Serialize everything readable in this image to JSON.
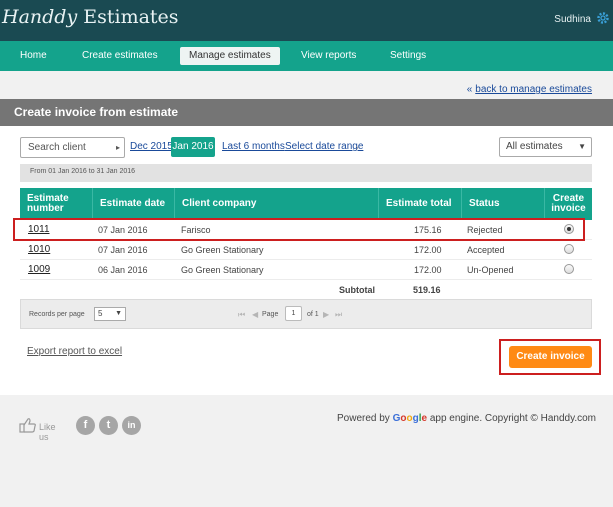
{
  "app": {
    "logo_script": "Handdy",
    "logo_text": "Estimates",
    "user_name": "Sudhina"
  },
  "nav": [
    {
      "label": "Home"
    },
    {
      "label": "Create estimates"
    },
    {
      "label": "Manage estimates"
    },
    {
      "label": "View reports"
    },
    {
      "label": "Settings"
    }
  ],
  "back_link": {
    "arrows": "«",
    "label": "back to manage estimates"
  },
  "panel": {
    "title": "Create invoice from estimate"
  },
  "filters": {
    "search_client": "Search client",
    "dec_2015": "Dec 2015",
    "jan_2016": "Jan 2016",
    "last_6_months": "Last 6 months",
    "select_date_range": "Select date range",
    "all_estimates": "All estimates",
    "date_range_text": "From 01 Jan 2016 to 31 Jan 2016"
  },
  "table": {
    "headers": {
      "estimate_number": "Estimate number",
      "estimate_date": "Estimate date",
      "client_company": "Client company",
      "estimate_total": "Estimate total",
      "status": "Status",
      "create_invoice": "Create invoice"
    },
    "rows": [
      {
        "number": "1011",
        "date": "07 Jan 2016",
        "client": "Farisco",
        "total": "175.16",
        "status": "Rejected",
        "selected": true
      },
      {
        "number": "1010",
        "date": "07 Jan 2016",
        "client": "Go Green Stationary",
        "total": "172.00",
        "status": "Accepted",
        "selected": false
      },
      {
        "number": "1009",
        "date": "06 Jan 2016",
        "client": "Go Green Stationary",
        "total": "172.00",
        "status": "Un-Opened",
        "selected": false
      }
    ],
    "subtotal_label": "Subtotal",
    "subtotal_value": "519.16"
  },
  "pager": {
    "records_per_page_label": "Records per page",
    "records_per_page": "5",
    "page_label": "Page",
    "page_value": "1",
    "of_label": "of 1"
  },
  "actions": {
    "export_label": "Export report to excel",
    "create_invoice_label": "Create invoice"
  },
  "footer": {
    "like_us": "Like us",
    "powered_prefix": "Powered by",
    "powered_suffix": "app engine. Copyright © Handdy.com",
    "google": [
      "G",
      "o",
      "o",
      "g",
      "l",
      "e"
    ]
  },
  "colors": {
    "topbar": "#1a4a52",
    "nav": "#14a38c",
    "accent_orange": "#ff8a14",
    "highlight_red": "#cc1f1f"
  }
}
